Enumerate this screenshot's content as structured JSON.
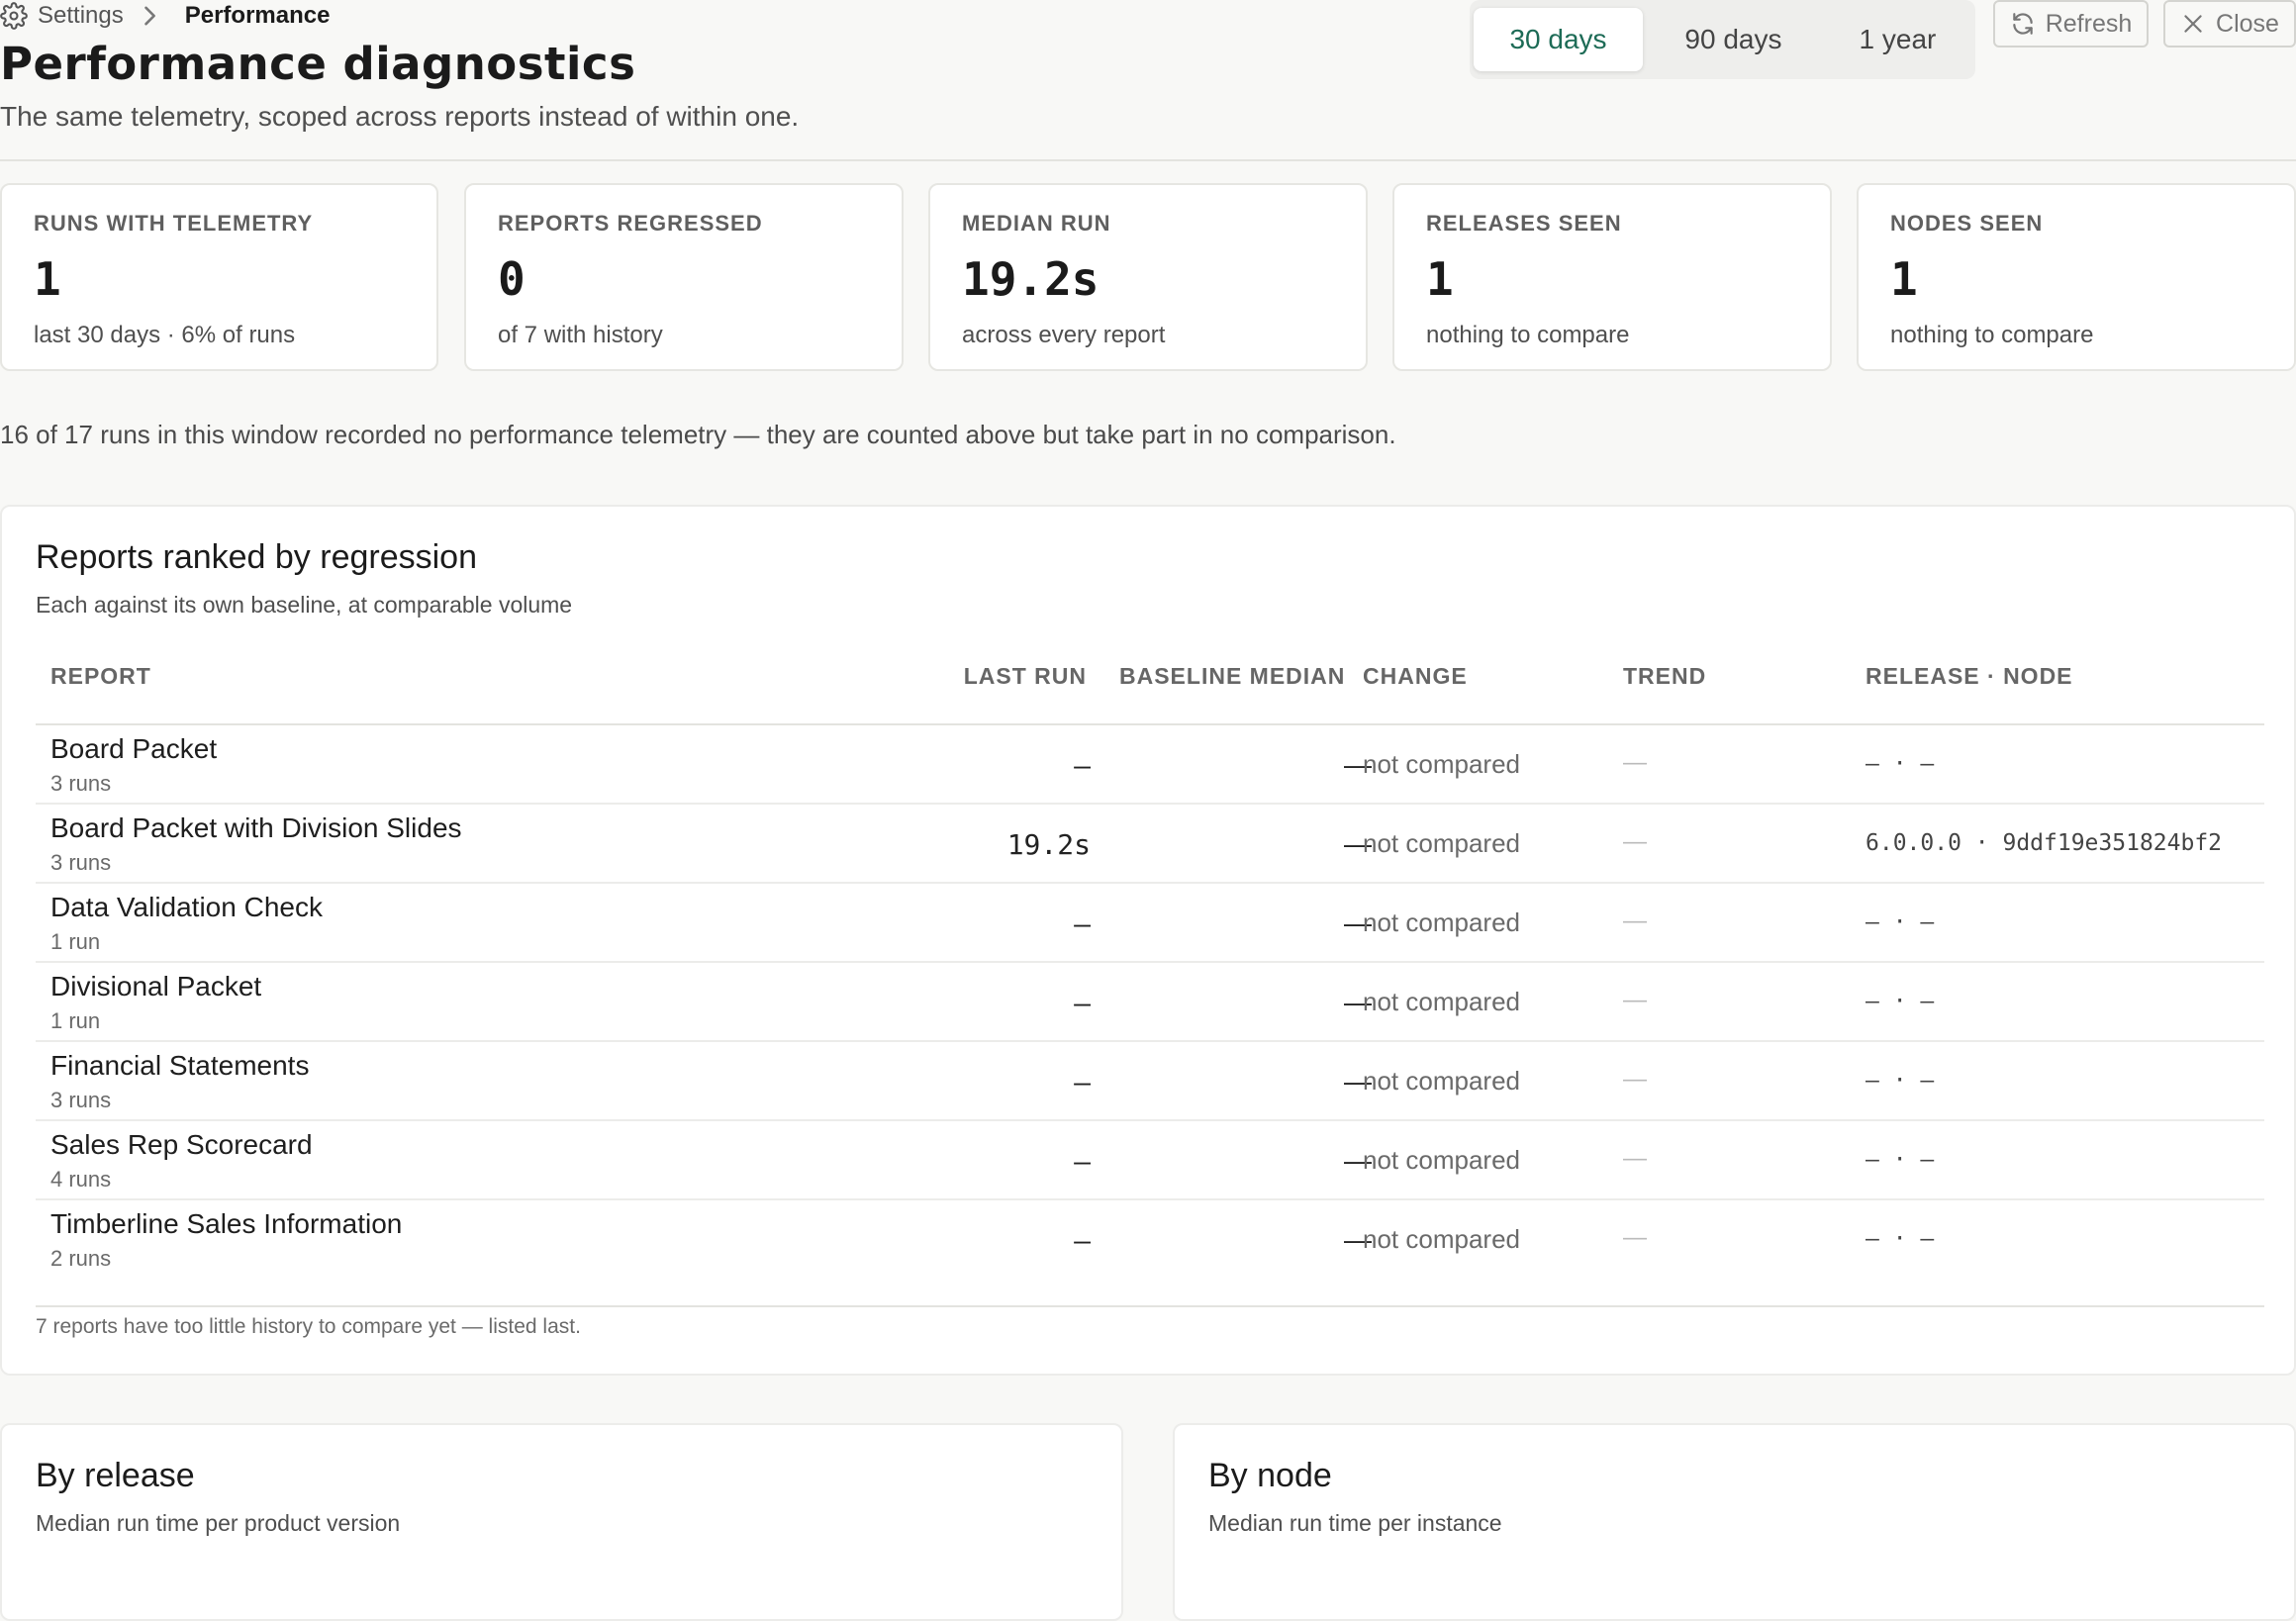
{
  "breadcrumb": {
    "root": "Settings",
    "current": "Performance"
  },
  "header": {
    "title": "Performance diagnostics",
    "subtitle": "The same telemetry, scoped across reports instead of within one."
  },
  "range": {
    "options": [
      "30 days",
      "90 days",
      "1 year"
    ],
    "selected": "30 days"
  },
  "actions": {
    "refresh": "Refresh",
    "close": "Close"
  },
  "stats": [
    {
      "label": "RUNS WITH TELEMETRY",
      "value": "1",
      "caption": "last 30 days · 6% of runs"
    },
    {
      "label": "REPORTS REGRESSED",
      "value": "0",
      "caption": "of 7 with history"
    },
    {
      "label": "MEDIAN RUN",
      "value": "19.2s",
      "caption": "across every report"
    },
    {
      "label": "RELEASES SEEN",
      "value": "1",
      "caption": "nothing to compare"
    },
    {
      "label": "NODES SEEN",
      "value": "1",
      "caption": "nothing to compare"
    }
  ],
  "notice": "16 of 17 runs in this window recorded no performance telemetry — they are counted above but take part in no comparison.",
  "ranking": {
    "title": "Reports ranked by regression",
    "subtitle": "Each against its own baseline, at comparable volume",
    "columns": {
      "report": "REPORT",
      "last_run": "LAST RUN",
      "baseline": "BASELINE MEDIAN",
      "change": "CHANGE",
      "trend": "TREND",
      "release_node": "RELEASE · NODE"
    },
    "rows": [
      {
        "name": "Board Packet",
        "runs": "3 runs",
        "last_run": "—",
        "baseline": "—",
        "change": "not compared",
        "trend": "—",
        "release_node": "— · —"
      },
      {
        "name": "Board Packet with Division Slides",
        "runs": "3 runs",
        "last_run": "19.2s",
        "baseline": "—",
        "change": "not compared",
        "trend": "—",
        "release_node": "6.0.0.0 · 9ddf19e351824bf2"
      },
      {
        "name": "Data Validation Check",
        "runs": "1 run",
        "last_run": "—",
        "baseline": "—",
        "change": "not compared",
        "trend": "—",
        "release_node": "— · —"
      },
      {
        "name": "Divisional Packet",
        "runs": "1 run",
        "last_run": "—",
        "baseline": "—",
        "change": "not compared",
        "trend": "—",
        "release_node": "— · —"
      },
      {
        "name": "Financial Statements",
        "runs": "3 runs",
        "last_run": "—",
        "baseline": "—",
        "change": "not compared",
        "trend": "—",
        "release_node": "— · —"
      },
      {
        "name": "Sales Rep Scorecard",
        "runs": "4 runs",
        "last_run": "—",
        "baseline": "—",
        "change": "not compared",
        "trend": "—",
        "release_node": "— · —"
      },
      {
        "name": "Timberline Sales Information",
        "runs": "2 runs",
        "last_run": "—",
        "baseline": "—",
        "change": "not compared",
        "trend": "—",
        "release_node": "— · —"
      }
    ],
    "footnote": "7 reports have too little history to compare yet — listed last."
  },
  "by_release": {
    "title": "By release",
    "subtitle": "Median run time per product version"
  },
  "by_node": {
    "title": "By node",
    "subtitle": "Median run time per instance"
  },
  "colors": {
    "accent": "#1d6b56",
    "background": "#f8f8f6",
    "card": "#ffffff",
    "border": "#e6e6e2"
  },
  "icons": {
    "settings": "gear-icon",
    "separator": "chevron-right-icon",
    "refresh": "refresh-icon",
    "close": "close-icon"
  }
}
